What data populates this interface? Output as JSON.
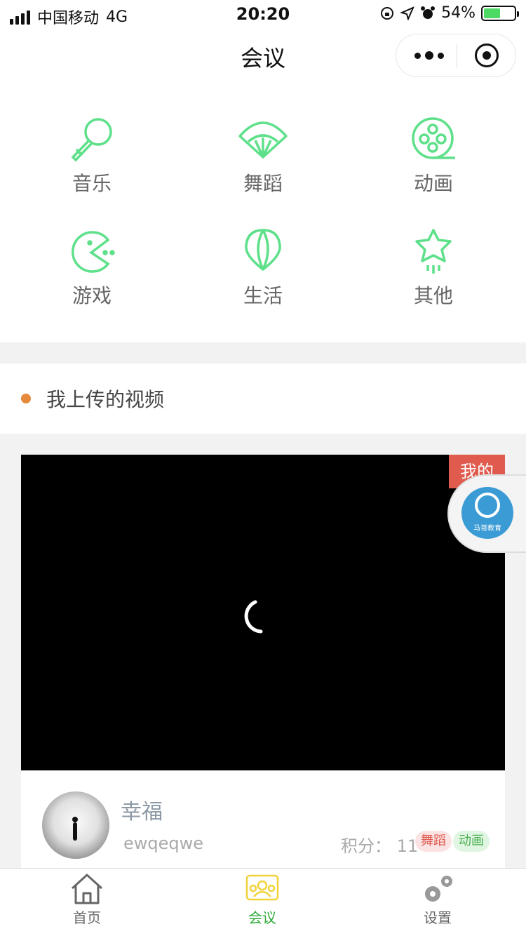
{
  "status_bar": {
    "carrier": "中国移动",
    "network": "4G",
    "time": "20:20",
    "battery": "54%",
    "battery_level": 0.54
  },
  "nav": {
    "title": "会议"
  },
  "categories": [
    {
      "label": "音乐",
      "icon": "microphone-icon"
    },
    {
      "label": "舞蹈",
      "icon": "fan-icon"
    },
    {
      "label": "动画",
      "icon": "film-reel-icon"
    },
    {
      "label": "游戏",
      "icon": "pacman-icon"
    },
    {
      "label": "生活",
      "icon": "balloon-icon"
    },
    {
      "label": "其他",
      "icon": "star-icon"
    }
  ],
  "section": {
    "title": "我上传的视频"
  },
  "video_card": {
    "tag": "我的",
    "user_name": "幸福",
    "user_id": "ewqeqwe",
    "score_label": "积分：",
    "score": "11",
    "tags": [
      "舞蹈",
      "动画"
    ]
  },
  "floating": {
    "text": "马哥教育",
    "icon": "mage-logo-icon"
  },
  "tabbar": [
    {
      "label": "首页",
      "icon": "home-icon",
      "active": false
    },
    {
      "label": "会议",
      "icon": "meeting-icon",
      "active": true
    },
    {
      "label": "设置",
      "icon": "gear-icon",
      "active": false
    }
  ],
  "colors": {
    "accent_green": "#5ee08a",
    "active_tab": "#2faa3a",
    "active_tab_icon": "#f1d23a",
    "tag_red": "#e05a4e",
    "dot_orange": "#e58a3c"
  }
}
